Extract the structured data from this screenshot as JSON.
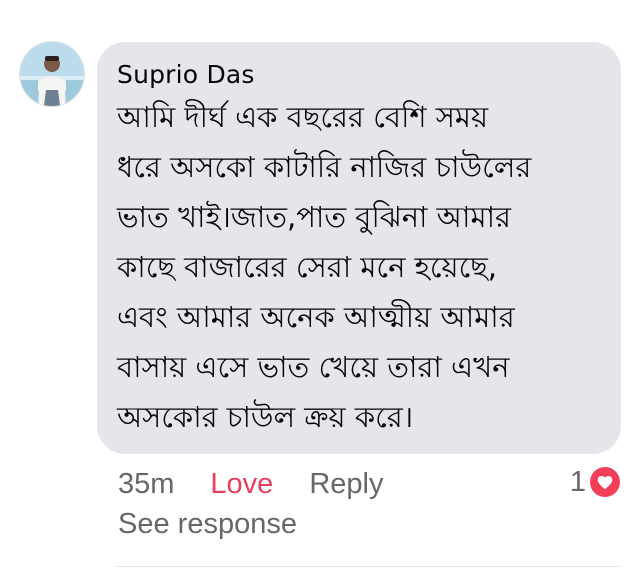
{
  "comment": {
    "author": "Suprio Das",
    "text": "আমি দীর্ঘ এক বছরের বেশি সময়\nধরে অসকো কাটারি নাজির চাউলের\nভাত খাই।জাত,পাত বুঝিনা আমার\nকাছে বাজারের সেরা মনে হয়েছে,\nএবং আমার অনেক আত্মীয় আমার\nবাসায় এসে ভাত খেয়ে তারা এখন\nঅসকোর চাউল ক্রয় করে।",
    "time": "35m",
    "reaction_label": "Love",
    "reply_label": "Reply",
    "reaction_count": "1",
    "see_response_label": "See response"
  },
  "colors": {
    "bubble": "#e4e6eb",
    "love_text": "#e4405f",
    "heart_badge": "#f33e58",
    "meta_text": "#65676b"
  },
  "icons": {
    "avatar": "profile-photo",
    "reaction": "heart-icon"
  }
}
